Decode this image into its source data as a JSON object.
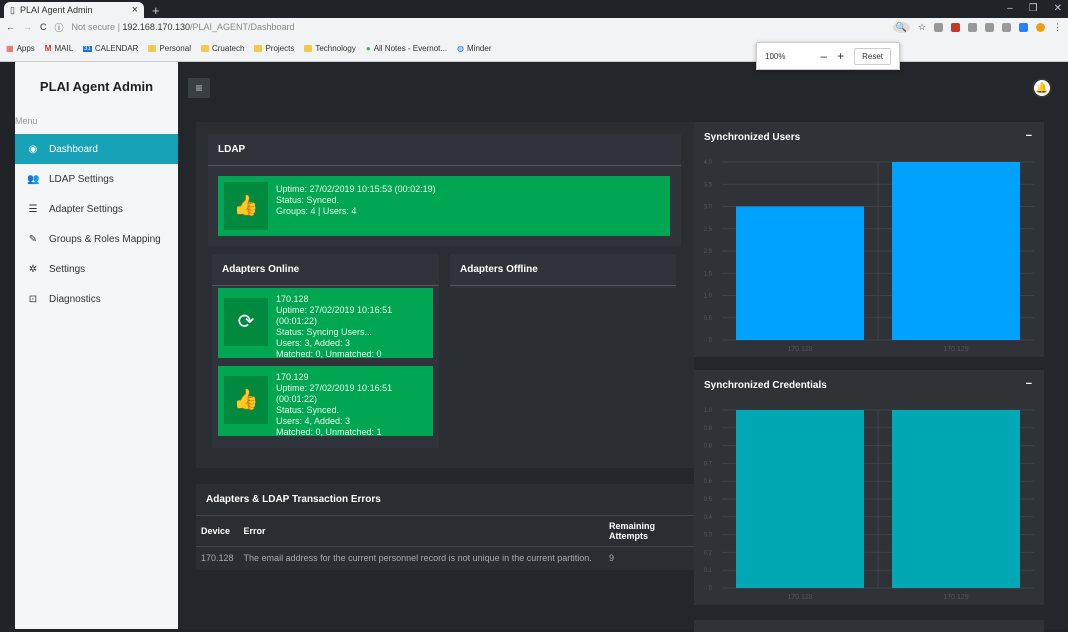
{
  "browser": {
    "tab_title": "PLAI Agent Admin",
    "url_host": "192.168.170.130",
    "url_path": "/PLAI_AGENT/Dashboard",
    "security": "Not secure",
    "bookmarks": [
      "Apps",
      "MAIL",
      "CALENDAR",
      "Personal",
      "Cruatech",
      "Projects",
      "Technology",
      "All Notes - Evernot...",
      "Minder"
    ],
    "zoom_level": "100%",
    "zoom_reset": "Reset"
  },
  "sidebar": {
    "brand": "PLAI Agent Admin",
    "menu_label": "Menu",
    "items": [
      {
        "label": "Dashboard",
        "icon": "dashboard-icon",
        "active": true
      },
      {
        "label": "LDAP Settings",
        "icon": "users-icon",
        "active": false
      },
      {
        "label": "Adapter Settings",
        "icon": "list-icon",
        "active": false
      },
      {
        "label": "Groups & Roles Mapping",
        "icon": "magic-icon",
        "active": false
      },
      {
        "label": "Settings",
        "icon": "gear-icon",
        "active": false
      },
      {
        "label": "Diagnostics",
        "icon": "diagnostics-icon",
        "active": false
      }
    ]
  },
  "ldap": {
    "title": "LDAP",
    "uptime": "Uptime: 27/02/2019 10:15:53 (00:02:19)",
    "status": "Status: Synced.",
    "groups": "Groups: 4 | Users: 4"
  },
  "adapters_online": {
    "title": "Adapters Online",
    "cards": [
      {
        "name": "170.128",
        "uptime": "Uptime: 27/02/2019 10:16:51 (00:01:22)",
        "status": "Status: Syncing Users...",
        "users": "Users: 3, Added: 3",
        "matched": "Matched: 0, Unmatched: 0",
        "icon": "sync-icon"
      },
      {
        "name": "170.129",
        "uptime": "Uptime: 27/02/2019 10:16:51 (00:01:22)",
        "status": "Status: Synced.",
        "users": "Users: 4, Added: 3",
        "matched": "Matched: 0, Unmatched: 1",
        "icon": "thumbs-up-icon"
      }
    ]
  },
  "adapters_offline": {
    "title": "Adapters Offline"
  },
  "errors": {
    "title": "Adapters & LDAP Transaction Errors",
    "headers": [
      "Device",
      "Error",
      "Remaining Attempts"
    ],
    "rows": [
      [
        "170.128",
        "The email address for the current personnel record is not unique in the current partition.",
        "9"
      ]
    ]
  },
  "chart_data": [
    {
      "type": "bar",
      "title": "Synchronized Users",
      "categories": [
        "170.128",
        "170.129"
      ],
      "values": [
        3,
        4
      ],
      "ylim": [
        0,
        4
      ],
      "yticks": [
        "0",
        "0.5",
        "1.0",
        "1.5",
        "2.0",
        "2.5",
        "3.0",
        "3.5",
        "4.0"
      ],
      "color": "#00a2ff",
      "grid": true
    },
    {
      "type": "bar",
      "title": "Synchronized Credentials",
      "categories": [
        "170.128",
        "170.129"
      ],
      "values": [
        1,
        1
      ],
      "ylim": [
        0,
        1
      ],
      "yticks": [
        "0",
        "0.1",
        "0.2",
        "0.3",
        "0.4",
        "0.5",
        "0.6",
        "0.7",
        "0.8",
        "0.9",
        "1.0"
      ],
      "color": "#00a8b5",
      "grid": true
    }
  ]
}
